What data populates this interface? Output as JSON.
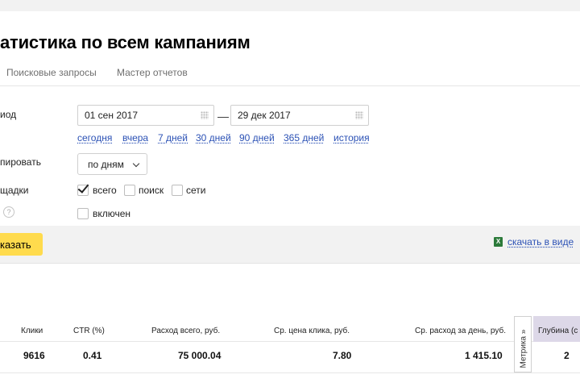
{
  "header": {
    "title": "атистика по всем кампаниям",
    "tabs": [
      "Поисковые запросы",
      "Мастер отчетов"
    ]
  },
  "period": {
    "label": "иод",
    "date_from": "01 сен 2017",
    "date_to": "29 дек 2017",
    "dash": "—",
    "quick_links": [
      "сегодня",
      "вчера",
      "7 дней",
      "30 дней",
      "90 дней",
      "365 дней",
      "история"
    ]
  },
  "grouping": {
    "label": "пировать",
    "selected": "по дням"
  },
  "sites": {
    "label": "щадки",
    "options": [
      {
        "label": "всего",
        "checked": true
      },
      {
        "label": "поиск",
        "checked": false
      },
      {
        "label": "сети",
        "checked": false
      }
    ]
  },
  "extra": {
    "help_icon": "?",
    "toggle_label": "включен",
    "checked": false
  },
  "actions": {
    "show_label": "казать",
    "download_label": "скачать в виде",
    "excel_icon": "X"
  },
  "table": {
    "headers": [
      "Клики",
      "CTR (%)",
      "Расход всего, руб.",
      "Ср. цена клика, руб.",
      "Ср. расход за день, руб."
    ],
    "row": [
      "9616",
      "0.41",
      "75 000.04",
      "7.80",
      "1 415.10"
    ],
    "metrika_label": "Метрика »",
    "depth_header": "Глубина (с",
    "depth_value": "2"
  },
  "colors": {
    "accent_yellow": "#ffdb4d",
    "link_blue": "#2b51b5",
    "highlight_column": "#ddd8e8"
  }
}
